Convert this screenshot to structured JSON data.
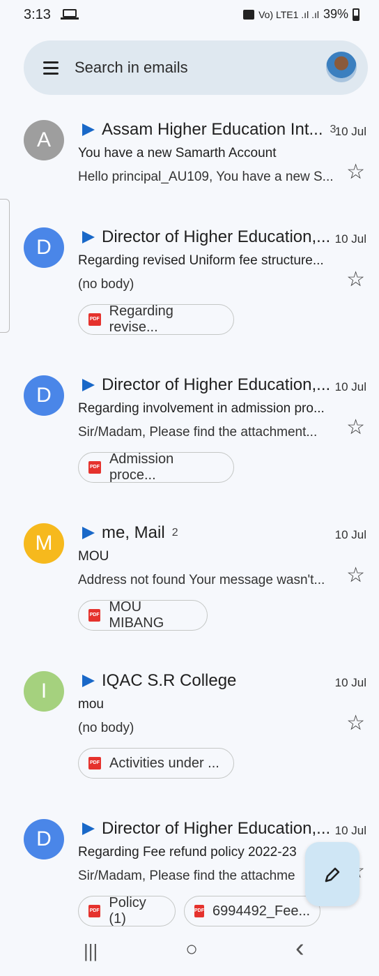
{
  "status": {
    "time": "3:13",
    "indicators": "Vo) LTE1 .ıl .ıl",
    "battery": "39%"
  },
  "search": {
    "placeholder": "Search in emails"
  },
  "emails": [
    {
      "avatar_letter": "A",
      "avatar_color": "#9e9e9e",
      "sender": "Assam Higher Education Int...",
      "count": "3",
      "date": "10 Jul",
      "subject": "You have a new Samarth Account",
      "snippet": "Hello principal_AU109, You have a new S..."
    },
    {
      "avatar_letter": "D",
      "avatar_color": "#4a86e8",
      "sender": "Director of Higher Education,...",
      "date": "10 Jul",
      "subject": "Regarding revised Uniform fee structure...",
      "snippet": "(no body)",
      "attachments": [
        "Regarding revise..."
      ]
    },
    {
      "avatar_letter": "D",
      "avatar_color": "#4a86e8",
      "sender": "Director of Higher Education,...",
      "date": "10 Jul",
      "subject": "Regarding involvement in admission pro...",
      "snippet": "Sir/Madam, Please find the attachment...",
      "attachments": [
        "Admission proce..."
      ]
    },
    {
      "avatar_letter": "M",
      "avatar_color": "#f6b91d",
      "sender": "me, Mail",
      "count": "2",
      "date": "10 Jul",
      "subject": "MOU",
      "snippet": "Address not found Your message wasn't...",
      "attachments": [
        "MOU MIBANG"
      ]
    },
    {
      "avatar_letter": "I",
      "avatar_color": "#a5d17e",
      "sender": "IQAC S.R College",
      "date": "10 Jul",
      "subject": "mou",
      "snippet": "(no body)",
      "attachments": [
        "Activities under ..."
      ]
    },
    {
      "avatar_letter": "D",
      "avatar_color": "#4a86e8",
      "sender": "Director of Higher Education,...",
      "date": "10 Jul",
      "subject": "Regarding Fee refund policy 2022-23",
      "snippet": "Sir/Madam, Please find the attachme",
      "attachments": [
        "Policy (1)",
        "6994492_Fee..."
      ]
    }
  ],
  "pdf_label": "PDF",
  "navbar": {
    "recents": "|||",
    "home": "○",
    "back": "‹"
  }
}
